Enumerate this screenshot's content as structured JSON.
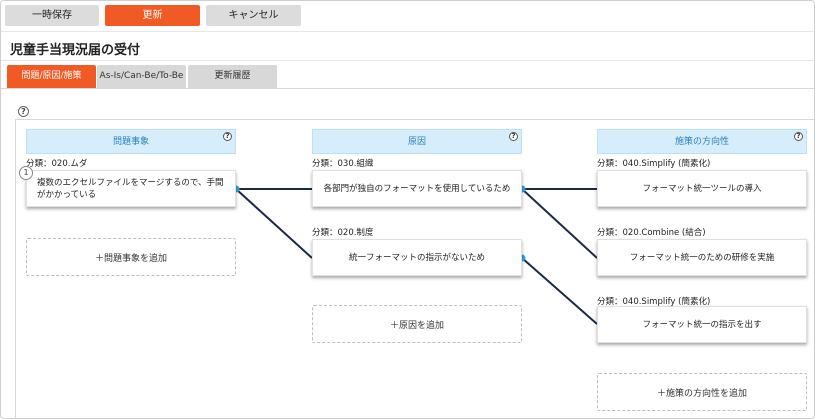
{
  "toolbar": {
    "save_label": "一時保存",
    "update_label": "更新",
    "cancel_label": "キャンセル"
  },
  "page": {
    "title": "児童手当現況届の受付"
  },
  "tabs": [
    {
      "label": "問題/原因/施策"
    },
    {
      "label": "As-Is/Can-Be/To-Be"
    },
    {
      "label": "更新履歴"
    }
  ],
  "help_symbol": "?",
  "columns": {
    "problem": {
      "header": "問題事象",
      "add_label": "＋問題事象を追加",
      "items": [
        {
          "number": "1",
          "category": "分類：020.ムダ",
          "text": "複数のエクセルファイルをマージするので、手間がかかっている"
        }
      ]
    },
    "cause": {
      "header": "原因",
      "add_label": "＋原因を追加",
      "items": [
        {
          "category": "分類：030.組織",
          "text": "各部門が独自のフォーマットを使用しているため"
        },
        {
          "category": "分類：020.制度",
          "text": "統一フォーマットの指示がないため"
        }
      ]
    },
    "measure": {
      "header": "施策の方向性",
      "add_label": "＋施策の方向性を追加",
      "items": [
        {
          "category": "分類：040.Simplify (簡素化)",
          "text": "フォーマット統一ツールの導入"
        },
        {
          "category": "分類：020.Combine (結合)",
          "text": "フォーマット統一のための研修を実施"
        },
        {
          "category": "分類：040.Simplify (簡素化)",
          "text": "フォーマット統一の指示を出す"
        }
      ]
    }
  },
  "colors": {
    "accent_orange": "#f15a24",
    "header_blue_bg": "#d6eefb",
    "header_blue_text": "#2a7fc2",
    "connector_dot": "#29a3e3",
    "connector_line": "#1d2a44"
  }
}
